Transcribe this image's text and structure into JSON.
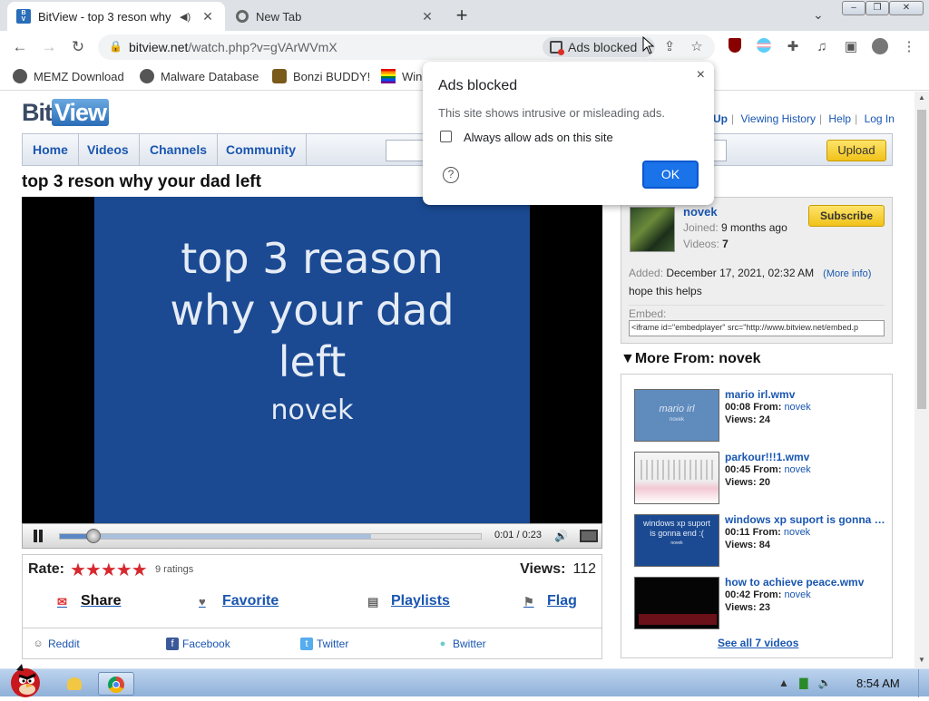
{
  "browser": {
    "tabs": [
      {
        "label": "BitView - top 3 reson why",
        "favicon": "Bit\nView",
        "audio_icon": "speaker-icon",
        "active": true
      },
      {
        "label": "New Tab",
        "favicon": "chrome-icon",
        "active": false
      }
    ],
    "url_domain": "bitview.net",
    "url_path": "/watch.php?v=gVArWVmX",
    "ad_chip_label": "Ads blocked",
    "bookmarks": [
      {
        "label": "MEMZ Download"
      },
      {
        "label": "Malware Database"
      },
      {
        "label": "Bonzi BUDDY!"
      },
      {
        "label": "Win"
      }
    ]
  },
  "site": {
    "logo_bit": "Bit",
    "logo_view": "View",
    "top_links": [
      "Up",
      "Viewing History",
      "Help",
      "Log In"
    ],
    "nav": [
      "Home",
      "Videos",
      "Channels",
      "Community"
    ],
    "upload_label": "Upload"
  },
  "video": {
    "title": "top 3 reson why your dad left",
    "slide_lines": [
      "top 3 reason",
      "why your dad",
      "left"
    ],
    "slide_author": "novek",
    "time": "0:01 / 0:23",
    "played_fraction": 0.08,
    "buffered_fraction": 0.74
  },
  "stats": {
    "rate_label": "Rate:",
    "stars": "★★★★★",
    "ratings_text": "9 ratings",
    "views_label": "Views:",
    "views_value": "112"
  },
  "actions": [
    {
      "label": "Share"
    },
    {
      "label": "Favorite"
    },
    {
      "label": "Playlists"
    },
    {
      "label": "Flag"
    }
  ],
  "share_targets": [
    "Reddit",
    "Facebook",
    "Twitter",
    "Bwitter"
  ],
  "uploader": {
    "name": "novek",
    "joined_label": "Joined:",
    "joined_value": "9 months ago",
    "videos_label": "Videos:",
    "videos_value": "7",
    "subscribe_label": "Subscribe",
    "added_label": "Added:",
    "added_value": "December 17, 2021, 02:32 AM",
    "more_info": "(More info)",
    "description": "hope this helps",
    "embed_label": "Embed:",
    "embed_code": "<iframe id=\"embedplayer\" src=\"http://www.bitview.net/embed.p"
  },
  "more_from": {
    "heading": "More From: novek",
    "items": [
      {
        "title": "mario irl.wmv",
        "duration": "00:08",
        "from_label": "From:",
        "author": "novek",
        "views_label": "Views:",
        "views": "24",
        "thumb_text": "mario irl",
        "thumb_sub": "novek"
      },
      {
        "title": "parkour!!!1.wmv",
        "duration": "00:45",
        "from_label": "From:",
        "author": "novek",
        "views_label": "Views:",
        "views": "20",
        "thumb_text": "",
        "thumb_sub": ""
      },
      {
        "title": "windows xp suport is gonna end :(",
        "duration": "00:11",
        "from_label": "From:",
        "author": "novek",
        "views_label": "Views:",
        "views": "84",
        "thumb_text": "windows xp suport is gonna end :(",
        "thumb_sub": "novek"
      },
      {
        "title": "how to achieve peace.wmv",
        "duration": "00:42",
        "from_label": "From:",
        "author": "novek",
        "views_label": "Views:",
        "views": "23",
        "thumb_text": "",
        "thumb_sub": ""
      }
    ],
    "see_all": "See all 7 videos"
  },
  "popup": {
    "title": "Ads blocked",
    "description": "This site shows intrusive or misleading ads.",
    "checkbox_label": "Always allow ads on this site",
    "help_glyph": "?",
    "ok_label": "OK",
    "close_glyph": "×"
  },
  "taskbar": {
    "clock": "8:54 AM"
  },
  "colors": {
    "link": "#1a56b0",
    "slide_bg": "#1b4a93",
    "ok_button": "#1a73e8",
    "stars": "#d8282f",
    "upload_button": "#f0c21a"
  }
}
